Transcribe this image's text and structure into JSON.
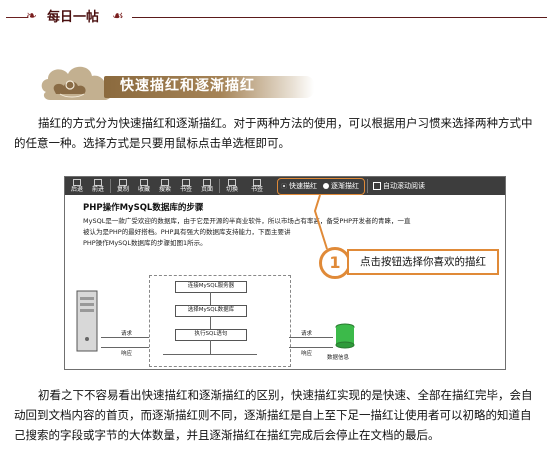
{
  "header": {
    "title": "每日一帖"
  },
  "section": {
    "heading": "快速描红和逐渐描红"
  },
  "paragraphs": {
    "intro": "描红的方式分为快速描红和逐渐描红。对于两种方法的使用，可以根据用户习惯来选择两种方式中的任意一种。选择方式是只要用鼠标点击单选框即可。",
    "explain": "初看之下不容易看出快速描红和逐渐描红的区别，快速描红实现的是快速、全部在描红完毕，会自动回到文档内容的首页，而逐渐描红则不同，逐渐描红是自上至下足一描红让使用者可以初略的知道自己搜索的字段或字节的大体数量，并且逐渐描红在描红完成后会停止在文档的最后。"
  },
  "figure": {
    "toolbar": {
      "buttons": [
        "后退",
        "前进",
        "复制",
        "收藏",
        "搜索",
        "书签",
        "页面",
        "切换",
        "书签"
      ],
      "modes": {
        "fast": "快速描红",
        "gradual": "逐渐描红",
        "auto_scroll": "自动滚动阅读"
      }
    },
    "doc": {
      "title": "PHP操作MySQL数据库的步骤",
      "lines": [
        "MySQL是一款广受欢迎的数据库，由于它是开源的半商业软件，所以市场占有率高，备受PHP开发者的青睐，一直",
        "被认为是PHP的最好搭档。PHP具有强大的数据库支持能力，下面主要讲",
        "PHP操作MySQL数据库的步骤如图1所示。"
      ]
    },
    "flow": {
      "steps": [
        "连接MySQL服务器",
        "选择MySQL数据库",
        "执行SQL语句"
      ],
      "request_label": "请求",
      "response_label": "响应",
      "db_label": "数据信息"
    },
    "callout": {
      "number": "1",
      "text": "点击按钮选择你喜欢的描红"
    }
  },
  "colors": {
    "accent": "#e08a38",
    "banner": "#8b6a3e",
    "header_text": "#4a0f0f",
    "toolbar": "#3d3d3d"
  }
}
